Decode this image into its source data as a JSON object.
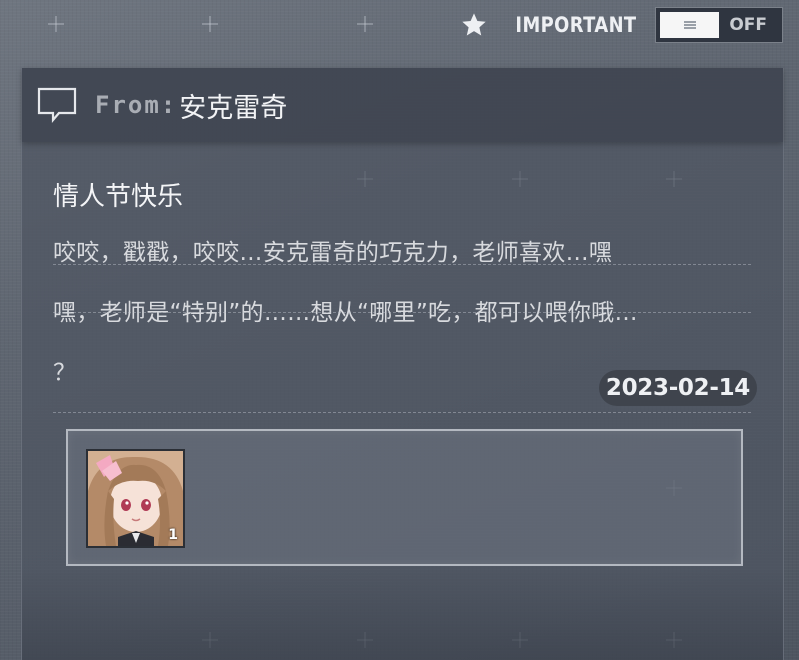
{
  "header": {
    "important_label": "IMPORTANT",
    "star_icon": "star-icon",
    "toggle_state": "OFF"
  },
  "mail": {
    "from_label": "From:",
    "sender": "安克雷奇",
    "subject": "情人节快乐",
    "body_lines": [
      "咬咬，戳戳，咬咬…安克雷奇的巧克力，老师喜欢…嘿",
      "嘿，老师是“特别”的……想从“哪里”吃，都可以喂你哦…",
      "？"
    ],
    "date": "2023-02-14",
    "attachment": {
      "icon": "anchorage-avatar-icon",
      "count": "1"
    }
  },
  "colors": {
    "accent_white": "#f4f5f7",
    "panel": "#4e5461",
    "badge": "#3f444d"
  }
}
